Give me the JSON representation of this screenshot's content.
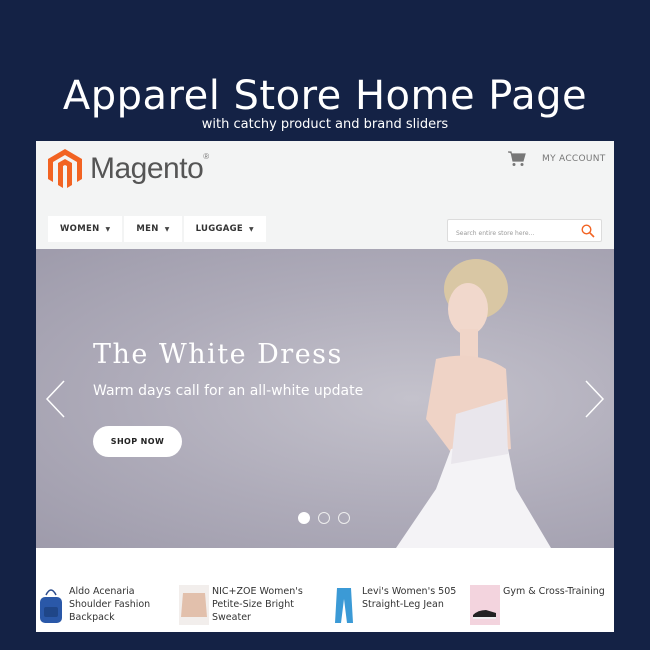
{
  "promo": {
    "title": "Apparel Store Home Page",
    "subtitle": "with catchy product and brand sliders"
  },
  "header": {
    "logo_text": "Magento",
    "logo_mark": "®",
    "cart_icon": "shopping-cart-icon",
    "account_label": "MY ACCOUNT"
  },
  "nav": {
    "items": [
      {
        "label": "WOMEN"
      },
      {
        "label": "MEN"
      },
      {
        "label": "LUGGAGE"
      }
    ],
    "caret": "▼"
  },
  "search": {
    "placeholder": "Search entire store here...",
    "value": "",
    "icon": "search-icon"
  },
  "hero": {
    "title": "The White Dress",
    "subtitle": "Warm days call for an all-white update",
    "button_label": "SHOP NOW",
    "slides_total": 3,
    "active_slide": 1
  },
  "products": [
    {
      "name": "Aldo Acenaria Shoulder Fashion Backpack",
      "thumb": "blue-backpack"
    },
    {
      "name": "NIC+ZOE Women's Petite-Size Bright Sweater",
      "thumb": "pink-sweater"
    },
    {
      "name": "Levi's Women's 505 Straight-Leg Jean",
      "thumb": "blue-jeans"
    },
    {
      "name": "Gym & Cross-Training",
      "thumb": "black-sneaker"
    }
  ],
  "colors": {
    "background": "#142245",
    "brand_orange": "#f26322",
    "header_bg": "#f3f4f4"
  }
}
